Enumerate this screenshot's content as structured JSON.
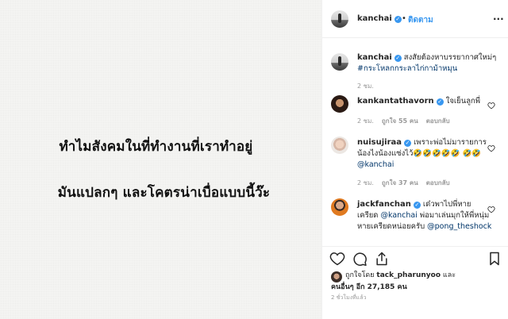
{
  "image": {
    "line1": "ทำไมสังคมในที่ทำงานที่เราทำอยู่",
    "line2": "มันแปลกๆ และโคตรน่าเบื่อแบบนี้ว๊ะ"
  },
  "header": {
    "username": "kanchai",
    "separator": "•",
    "follow": "ติดตาม",
    "more": "..."
  },
  "caption": {
    "username": "kanchai",
    "text": "สงสัยต้องหาบรรยากาศใหม่ๆ",
    "hashtag": "#กระโหลกกระลาไก่กาม้าหมุน",
    "time": "2 ชม."
  },
  "comments": [
    {
      "username": "kankantathavorn",
      "text": "ใจเย็นลูกพี่",
      "time": "2 ชม.",
      "likes": "ถูกใจ 55 คน",
      "reply": "ตอบกลับ"
    },
    {
      "username": "nuisujiraa",
      "text": "เพราะพ่อไม่มารายการ น้องไงน้องแซ่งไว้🤣🤣🤣🤣🤣",
      "text2": "🤣🤣",
      "mention": "@kanchai",
      "time": "2 ชม.",
      "likes": "ถูกใจ 37 คน",
      "reply": "ตอบกลับ"
    },
    {
      "username": "jackfanchan",
      "text": "เด๋วพาไปพี่หาย เครียด",
      "mention": "@kanchai",
      "text2": "พ่อมาเล่นมุกให้พี่หนุ่มหายเครียดหน่อยครับ",
      "mention2": "@pong_theshock"
    }
  ],
  "likes": {
    "prefix": "ถูกใจโดย",
    "user": "tack_pharunyoo",
    "and": "และ",
    "others": "คนอื่นๆ อีก 27,185 คน"
  },
  "posted": "2 ชั่วโมงที่แล้ว",
  "icons": {
    "heart": "heart-icon",
    "comment": "comment-icon",
    "share": "share-icon",
    "bookmark": "bookmark-icon",
    "verified": "verified-badge-icon"
  },
  "colors": {
    "link": "#003569",
    "follow": "#3897f0",
    "muted": "#999999",
    "text": "#262626"
  }
}
